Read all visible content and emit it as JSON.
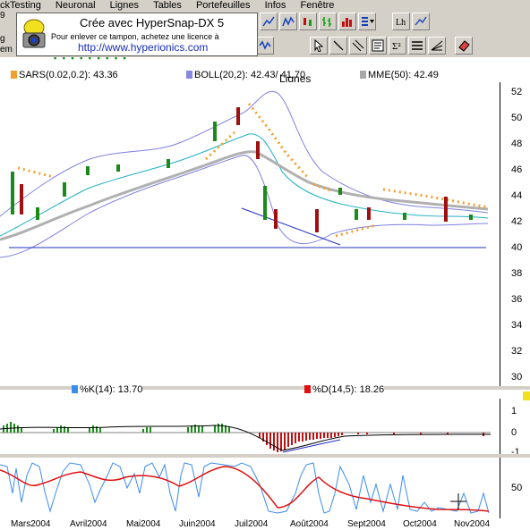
{
  "menu": {
    "items": [
      "ckTesting",
      "Neuronal",
      "Lignes",
      "Tables",
      "Portefeuilles",
      "Infos",
      "Fenêtre"
    ]
  },
  "left_strip": {
    "texts": [
      "9",
      "g",
      "em"
    ]
  },
  "toolbar": {
    "lignes_label": "Lignes"
  },
  "hypersnap": {
    "title": "Crée avec HyperSnap-DX 5",
    "subtitle": "Pour enlever ce tampon, achetez une licence à",
    "url": "http://www.hyperionics.com"
  },
  "indicators": {
    "sar": {
      "label": "SARS(0.02,0.2): 43.36",
      "color": "#f0a030"
    },
    "boll": {
      "label": "BOLL(20,2): 42.43/ 41.70",
      "color": "#8888e0"
    },
    "mme": {
      "label": "MME(50): 42.49",
      "color": "#a8a8a8"
    },
    "k": {
      "label": "%K(14): 13.70",
      "color": "#3c8cf0"
    },
    "d": {
      "label": "%D(14,5): 18.26",
      "color": "#e01010"
    }
  },
  "price_axis": {
    "ticks": [
      "52",
      "50",
      "48",
      "46",
      "44",
      "42",
      "40",
      "38",
      "36",
      "34",
      "32",
      "30"
    ]
  },
  "macd_axis": {
    "ticks": [
      "1",
      "0",
      "-1"
    ]
  },
  "stoch_axis": {
    "ticks": [
      "50"
    ]
  },
  "x_axis": {
    "months": [
      "Mars2004",
      "Avril2004",
      "Mai2004",
      "Juin2004",
      "Juil2004",
      "Août2004",
      "Sept2004",
      "Oct2004",
      "Nov2004"
    ]
  },
  "colors": {
    "candle_up": "#1a8a1a",
    "candle_down": "#a01010",
    "trendline": "#2030c0",
    "support": "#2030c0",
    "toolbar_bg": "#d4d0c8"
  }
}
